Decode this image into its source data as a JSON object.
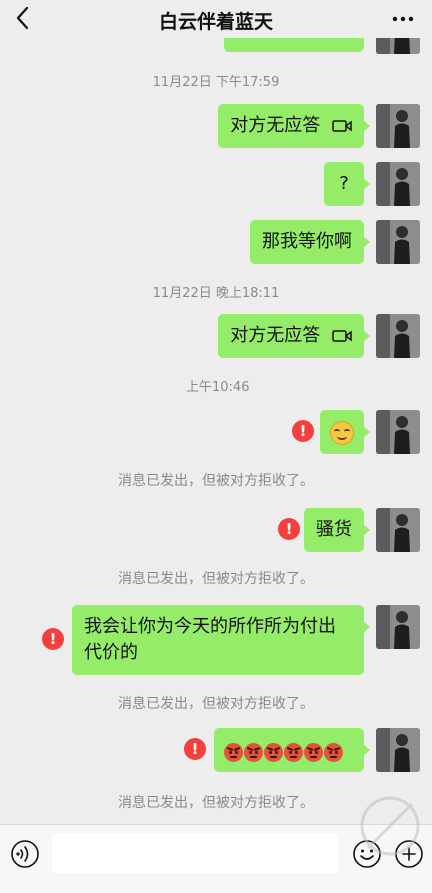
{
  "header": {
    "title": "白云伴着蓝天"
  },
  "messages": {
    "t1": "11月22日 下午17:59",
    "m1": "对方无应答",
    "m2": "?",
    "m3": "那我等你啊",
    "t2": "11月22日 晚上18:11",
    "m4": "对方无应答",
    "t3": "上午10:46",
    "m6": "骚货",
    "m7": "我会让你为今天的所作所为付出代价的",
    "notice": "消息已发出，但被对方拒收了。",
    "error_mark": "!"
  },
  "colors": {
    "bubble_sent": "#95ec69",
    "error": "#f43f3f",
    "background": "#ededed"
  },
  "icons": {
    "back": "chevron-left-icon",
    "more": "more-dots-icon",
    "voice": "voice-icon",
    "emoji": "emoji-icon",
    "plus": "plus-icon",
    "call": "video-call-icon"
  },
  "input": {
    "placeholder": ""
  }
}
